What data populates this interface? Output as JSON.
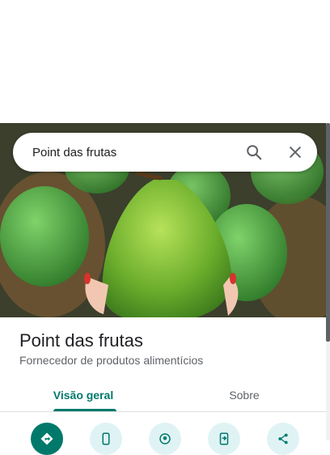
{
  "search": {
    "value": "Point das frutas"
  },
  "place": {
    "title": "Point das frutas",
    "category": "Fornecedor de produtos alimentícios"
  },
  "tabs": [
    {
      "label": "Visão geral",
      "selected": true
    },
    {
      "label": "Sobre",
      "selected": false
    }
  ],
  "actions": [
    {
      "icon": "directions-icon"
    },
    {
      "icon": "phone-icon"
    },
    {
      "icon": "nearby-icon"
    },
    {
      "icon": "save-to-phone-icon"
    },
    {
      "icon": "share-icon"
    }
  ],
  "colors": {
    "accent": "#00796b",
    "action_bg": "#dff3f5"
  }
}
